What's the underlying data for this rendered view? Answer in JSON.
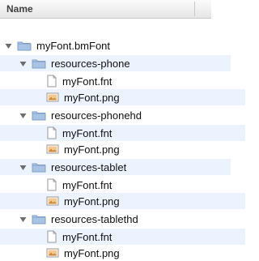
{
  "header": {
    "name_label": "Name"
  },
  "tree": [
    {
      "label": "myFont.bmFont",
      "type": "folder",
      "depth": 0,
      "expanded": true
    },
    {
      "label": "resources-phone",
      "type": "folder",
      "depth": 1,
      "expanded": true
    },
    {
      "label": "myFont.fnt",
      "type": "file-text",
      "depth": 2
    },
    {
      "label": "myFont.png",
      "type": "file-image",
      "depth": 2
    },
    {
      "label": "resources-phonehd",
      "type": "folder",
      "depth": 1,
      "expanded": true
    },
    {
      "label": "myFont.fnt",
      "type": "file-text",
      "depth": 2
    },
    {
      "label": "myFont.png",
      "type": "file-image",
      "depth": 2
    },
    {
      "label": "resources-tablet",
      "type": "folder",
      "depth": 1,
      "expanded": true
    },
    {
      "label": "myFont.fnt",
      "type": "file-text",
      "depth": 2
    },
    {
      "label": "myFont.png",
      "type": "file-image",
      "depth": 2
    },
    {
      "label": "resources-tablethd",
      "type": "folder",
      "depth": 1,
      "expanded": true
    },
    {
      "label": "myFont.fnt",
      "type": "file-text",
      "depth": 2
    },
    {
      "label": "myFont.png",
      "type": "file-image",
      "depth": 2
    }
  ],
  "colors": {
    "zebra": "#edf3fe",
    "folder": "#a9c4e3",
    "triangle": "#6d6d6d"
  },
  "icons": {
    "disclosure": "disclosure-triangle-icon",
    "folder": "folder-icon",
    "text_file": "text-file-icon",
    "image_file": "image-file-icon"
  }
}
